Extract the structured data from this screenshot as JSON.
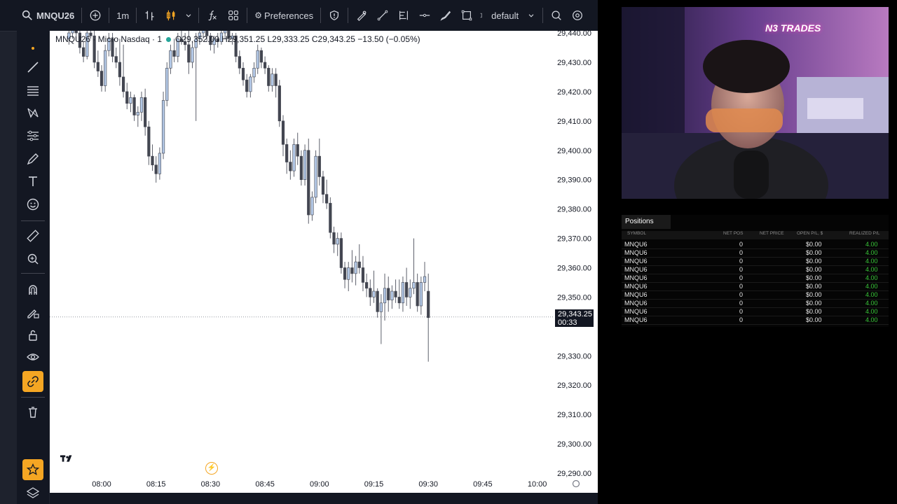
{
  "toolbar": {
    "symbol": "MNQU26",
    "interval": "1m",
    "preferences_label": "Preferences",
    "layout_name": "default"
  },
  "chart": {
    "legend": {
      "title": "MNQU26 · Micro Nasdaq · 1",
      "values": "O29,352.00 H29,351.25 L29,333.25 C29,343.25 −13.50 (−0.05%)"
    },
    "last_price": "29,343.25",
    "countdown": "00:33",
    "y_ticks": [
      "29,440.00",
      "29,430.00",
      "29,420.00",
      "29,410.00",
      "29,400.00",
      "29,390.00",
      "29,380.00",
      "29,370.00",
      "29,360.00",
      "29,350.00",
      "29,330.00",
      "29,320.00",
      "29,310.00",
      "29,300.00",
      "29,290.00"
    ],
    "x_ticks": [
      "08:00",
      "08:15",
      "08:30",
      "08:45",
      "09:00",
      "09:15",
      "09:30",
      "09:45",
      "10:00"
    ],
    "colors": {
      "up": "#b3c8e6",
      "down": "#434651",
      "wick": "#5d606b",
      "background": "#ffffff"
    }
  },
  "chart_data": {
    "type": "candlestick",
    "x_start": "07:51",
    "interval_minutes": 1,
    "ylim": [
      29285,
      29445
    ],
    "ohlc": [
      [
        29438,
        29442,
        29436,
        29440
      ],
      [
        29440,
        29442,
        29438,
        29441
      ],
      [
        29441,
        29443,
        29439,
        29440
      ],
      [
        29440,
        29441,
        29433,
        29435
      ],
      [
        29435,
        29437,
        29430,
        29432
      ],
      [
        29432,
        29441,
        29431,
        29440
      ],
      [
        29440,
        29442,
        29438,
        29439
      ],
      [
        29439,
        29441,
        29428,
        29430
      ],
      [
        29430,
        29434,
        29425,
        29427
      ],
      [
        29427,
        29429,
        29420,
        29422
      ],
      [
        29422,
        29436,
        29420,
        29434
      ],
      [
        29434,
        29440,
        29432,
        29438
      ],
      [
        29438,
        29440,
        29430,
        29432
      ],
      [
        29432,
        29435,
        29428,
        29430
      ],
      [
        29430,
        29438,
        29422,
        29425
      ],
      [
        29425,
        29436,
        29418,
        29420
      ],
      [
        29420,
        29423,
        29414,
        29416
      ],
      [
        29416,
        29420,
        29413,
        29418
      ],
      [
        29418,
        29419,
        29410,
        29412
      ],
      [
        29412,
        29415,
        29408,
        29413
      ],
      [
        29413,
        29420,
        29410,
        29418
      ],
      [
        29418,
        29421,
        29405,
        29408
      ],
      [
        29408,
        29410,
        29395,
        29398
      ],
      [
        29398,
        29402,
        29393,
        29395
      ],
      [
        29395,
        29398,
        29389,
        29392
      ],
      [
        29392,
        29401,
        29390,
        29399
      ],
      [
        29399,
        29420,
        29397,
        29417
      ],
      [
        29417,
        29430,
        29415,
        29428
      ],
      [
        29428,
        29436,
        29426,
        29434
      ],
      [
        29434,
        29438,
        29430,
        29432
      ],
      [
        29432,
        29440,
        29430,
        29438
      ],
      [
        29438,
        29442,
        29436,
        29437
      ],
      [
        29437,
        29440,
        29434,
        29436
      ],
      [
        29436,
        29442,
        29426,
        29430
      ],
      [
        29430,
        29437,
        29428,
        29435
      ],
      [
        29435,
        29440,
        29410,
        29438
      ],
      [
        29438,
        29441,
        29436,
        29440
      ],
      [
        29440,
        29442,
        29438,
        29441
      ],
      [
        29441,
        29443,
        29437,
        29439
      ],
      [
        29439,
        29440,
        29434,
        29436
      ],
      [
        29436,
        29439,
        29433,
        29438
      ],
      [
        29438,
        29440,
        29435,
        29437
      ],
      [
        29437,
        29441,
        29436,
        29440
      ],
      [
        29440,
        29442,
        29438,
        29441
      ],
      [
        29441,
        29442,
        29437,
        29438
      ],
      [
        29438,
        29440,
        29436,
        29439
      ],
      [
        29439,
        29440,
        29430,
        29432
      ],
      [
        29432,
        29434,
        29426,
        29428
      ],
      [
        29428,
        29430,
        29422,
        29424
      ],
      [
        29424,
        29426,
        29418,
        29420
      ],
      [
        29420,
        29426,
        29418,
        29425
      ],
      [
        29425,
        29430,
        29423,
        29428
      ],
      [
        29428,
        29436,
        29426,
        29434
      ],
      [
        29434,
        29435,
        29428,
        29430
      ],
      [
        29430,
        29432,
        29426,
        29428
      ],
      [
        29428,
        29429,
        29420,
        29422
      ],
      [
        29422,
        29428,
        29420,
        29426
      ],
      [
        29426,
        29428,
        29418,
        29422
      ],
      [
        29422,
        29424,
        29408,
        29410
      ],
      [
        29410,
        29412,
        29398,
        29402
      ],
      [
        29402,
        29404,
        29392,
        29396
      ],
      [
        29396,
        29400,
        29390,
        29393
      ],
      [
        29393,
        29404,
        29391,
        29402
      ],
      [
        29402,
        29406,
        29395,
        29398
      ],
      [
        29398,
        29400,
        29388,
        29390
      ],
      [
        29390,
        29402,
        29388,
        29400
      ],
      [
        29400,
        29404,
        29375,
        29378
      ],
      [
        29378,
        29386,
        29376,
        29384
      ],
      [
        29384,
        29400,
        29382,
        29398
      ],
      [
        29398,
        29404,
        29388,
        29391
      ],
      [
        29391,
        29393,
        29382,
        29385
      ],
      [
        29385,
        29390,
        29380,
        29382
      ],
      [
        29382,
        29384,
        29370,
        29372
      ],
      [
        29372,
        29374,
        29365,
        29368
      ],
      [
        29368,
        29372,
        29364,
        29370
      ],
      [
        29370,
        29372,
        29358,
        29360
      ],
      [
        29360,
        29362,
        29353,
        29356
      ],
      [
        29356,
        29362,
        29352,
        29360
      ],
      [
        29360,
        29366,
        29355,
        29358
      ],
      [
        29358,
        29364,
        29354,
        29362
      ],
      [
        29362,
        29368,
        29358,
        29360
      ],
      [
        29360,
        29364,
        29352,
        29355
      ],
      [
        29355,
        29358,
        29350,
        29353
      ],
      [
        29353,
        29356,
        29347,
        29350
      ],
      [
        29350,
        29359,
        29348,
        29352
      ],
      [
        29352,
        29353,
        29343,
        29345
      ],
      [
        29345,
        29351,
        29334,
        29348
      ],
      [
        29348,
        29358,
        29342,
        29353
      ],
      [
        29353,
        29357,
        29345,
        29349
      ],
      [
        29349,
        29354,
        29346,
        29352
      ],
      [
        29352,
        29356,
        29348,
        29350
      ],
      [
        29350,
        29356,
        29346,
        29348
      ],
      [
        29348,
        29357,
        29345,
        29355
      ],
      [
        29355,
        29360,
        29347,
        29350
      ],
      [
        29350,
        29356,
        29346,
        29353
      ],
      [
        29353,
        29370,
        29351,
        29355
      ],
      [
        29355,
        29358,
        29345,
        29347
      ],
      [
        29347,
        29357,
        29344,
        29355
      ],
      [
        29355,
        29362,
        29352,
        29357
      ],
      [
        29352,
        29358,
        29328,
        29343
      ]
    ]
  },
  "webcam": {
    "logo_text": "N3 TRADES"
  },
  "positions": {
    "tab_label": "Positions",
    "columns": [
      "SYMBOL",
      "NET POS",
      "NET PRICE",
      "OPEN P/L, $",
      "REALIZED P/L"
    ],
    "rows": [
      [
        "MNQU6",
        "0",
        "",
        "$0.00",
        "4.00"
      ],
      [
        "MNQU6",
        "0",
        "",
        "$0.00",
        "4.00"
      ],
      [
        "MNQU6",
        "0",
        "",
        "$0.00",
        "4.00"
      ],
      [
        "MNQU6",
        "0",
        "",
        "$0.00",
        "4.00"
      ],
      [
        "MNQU6",
        "0",
        "",
        "$0.00",
        "4.00"
      ],
      [
        "MNQU6",
        "0",
        "",
        "$0.00",
        "4.00"
      ],
      [
        "MNQU6",
        "0",
        "",
        "$0.00",
        "4.00"
      ],
      [
        "MNQU6",
        "0",
        "",
        "$0.00",
        "4.00"
      ],
      [
        "MNQU6",
        "0",
        "",
        "$0.00",
        "4.00"
      ],
      [
        "MNQU6",
        "0",
        "",
        "$0.00",
        "4.00"
      ]
    ]
  }
}
